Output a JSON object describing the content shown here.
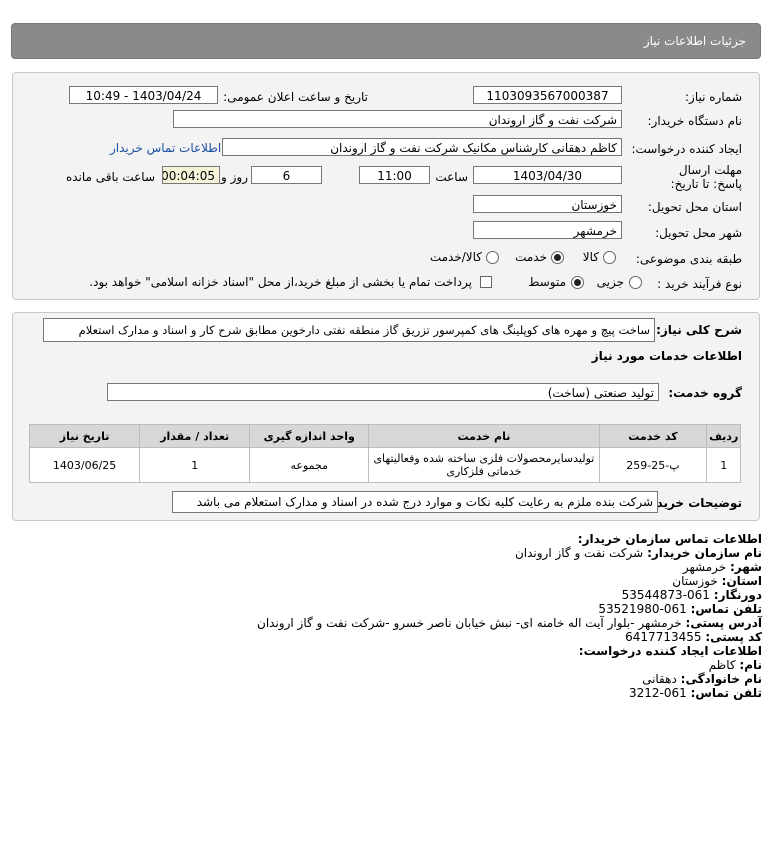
{
  "header": {
    "title": "جزئیات اطلاعات نیاز"
  },
  "details": {
    "need_number_label": "شماره نیاز:",
    "need_number": "1103093567000387",
    "announce_label": "تاریخ و ساعت اعلان عمومی:",
    "announce_value": "1403/04/24 - 10:49",
    "buyer_org_label": "نام دستگاه خریدار:",
    "buyer_org": "شرکت نفت و گاز اروندان",
    "requester_label": "ایجاد کننده درخواست:",
    "requester": "کاظم دهقانی کارشناس مکانیک شرکت نفت و گاز اروندان",
    "contact_link": "اطلاعات تماس خریدار",
    "deadline_label": "مهلت ارسال پاسخ: تا تاریخ:",
    "deadline_date": "1403/04/30",
    "time_label": "ساعت",
    "deadline_time": "11:00",
    "days": "6",
    "days_label": "روز و",
    "remaining": "00:04:05",
    "remaining_label": "ساعت باقی مانده",
    "province_label": "استان محل تحویل:",
    "province": "خوزستان",
    "city_label": "شهر محل تحویل:",
    "city": "خرمشهر",
    "category_label": "طبقه بندی موضوعی:",
    "category_options": [
      "کالا",
      "خدمت",
      "کالا/خدمت"
    ],
    "process_label": "نوع فرآیند خرید :",
    "process_options": [
      "جزیی",
      "متوسط"
    ],
    "payment_text": "پرداخت تمام یا بخشی از مبلغ خرید،از محل \"اسناد خزانه اسلامی\" خواهد بود."
  },
  "service": {
    "description_label": "شرح کلی نیاز:",
    "description": "ساخت پیچ و مهره های کوپلینگ های کمپرسور تزریق گاز منطقه نفتی دارخوین مطابق شرح کار و اسناد و مدارک استعلام",
    "section_title": "اطلاعات خدمات مورد نیاز",
    "group_label": "گروه خدمت:",
    "group_value": "تولید صنعتی (ساخت)",
    "columns": [
      "ردیف",
      "کد خدمت",
      "نام خدمت",
      "واحد اندازه گیری",
      "تعداد / مقدار",
      "تاریخ نیاز"
    ],
    "rows": [
      [
        "1",
        "پ-25-259",
        "تولیدسایرمحصولات فلزی ساخته شده وفعالیتهای خدماتی فلزکاری",
        "مجموعه",
        "1",
        "1403/06/25"
      ]
    ],
    "notes_label": "توضیحات خریدار:",
    "notes": "شرکت بنده ملزم به رعایت کلیه نکات و موارد درج شده در اسناد و مدارک استعلام می باشد"
  },
  "contact": {
    "title": "اطلاعات تماس سازمان خریدار:",
    "org_label": "نام سازمان خریدار:",
    "org": "شرکت نفت و گاز اروندان",
    "city_label": "شهر:",
    "city": "خرمشهر",
    "province_label": "استان:",
    "province": "خوزستان",
    "fax_label": "دورنگار:",
    "fax": "061-53544873",
    "phone_label": "تلفن تماس:",
    "phone": "061-53521980",
    "address_label": "آدرس پستی:",
    "address": "خرمشهر -بلوار آیت اله خامنه ای- نبش خیابان ناصر خسرو -شرکت نفت و گاز اروندان",
    "postal_label": "کد پستی:",
    "postal": "6417713455",
    "creator_title": "اطلاعات ایجاد کننده درخواست:",
    "name_label": "نام:",
    "name": "کاظم",
    "family_label": "نام خانوادگی:",
    "family": "دهقانی",
    "creator_phone_label": "تلفن تماس:",
    "creator_phone": "061-3212"
  }
}
